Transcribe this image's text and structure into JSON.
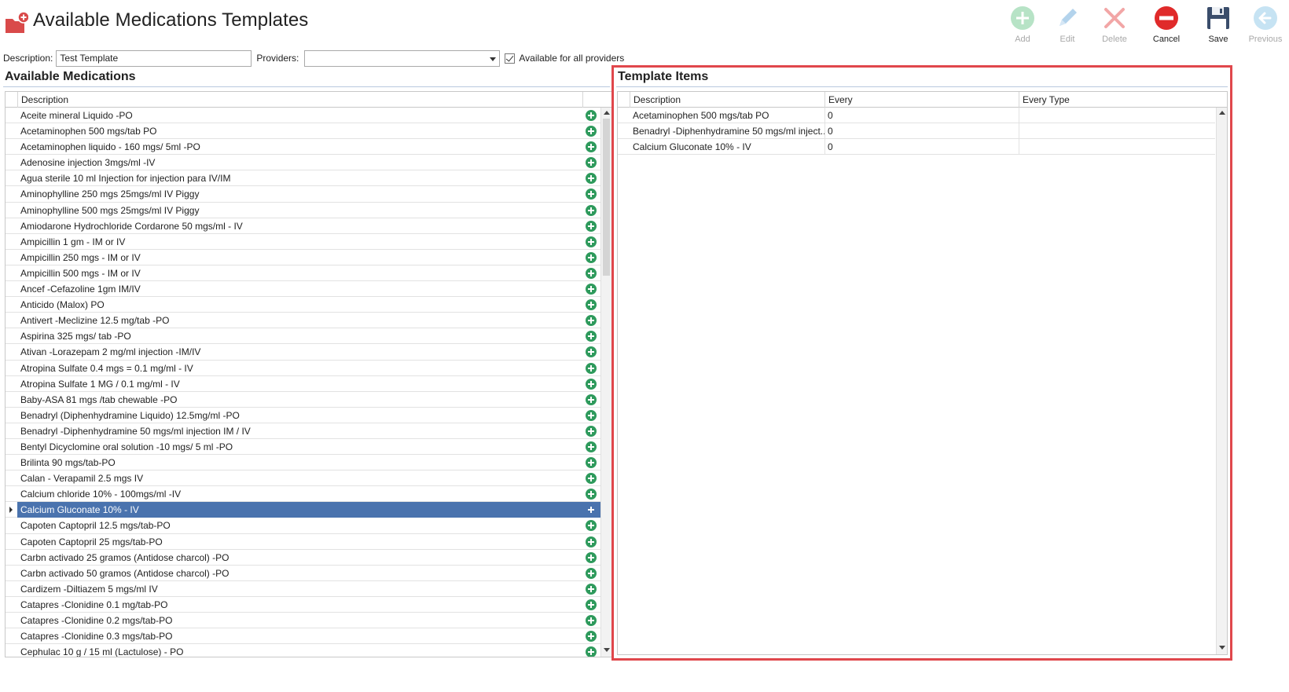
{
  "header": {
    "title": "Available Medications Templates"
  },
  "toolbar": {
    "add": "Add",
    "edit": "Edit",
    "delete": "Delete",
    "cancel": "Cancel",
    "save": "Save",
    "previous": "Previous"
  },
  "form": {
    "description_label": "Description:",
    "description_value": "Test Template",
    "providers_label": "Providers:",
    "providers_value": "",
    "available_all_label": "Available for all providers",
    "available_all_checked": true
  },
  "available": {
    "title": "Available Medications",
    "column": "Description",
    "selected_index": 25,
    "rows": [
      "Aceite mineral Liquido -PO",
      "Acetaminophen 500 mgs/tab PO",
      "Acetaminophen liquido - 160 mgs/ 5ml -PO",
      "Adenosine injection 3mgs/ml -IV",
      "Agua sterile 10 ml Injection for injection para IV/IM",
      "Aminophylline 250 mgs 25mgs/ml IV Piggy",
      "Aminophylline 500 mgs 25mgs/ml IV Piggy",
      "Amiodarone Hydrochloride Cordarone 50 mgs/ml - IV",
      "Ampicillin 1 gm - IM or IV",
      "Ampicillin 250 mgs - IM or IV",
      "Ampicillin 500 mgs - IM or IV",
      "Ancef -Cefazoline  1gm IM/IV",
      "Anticido (Malox) PO",
      "Antivert -Meclizine 12.5 mg/tab -PO",
      "Aspirina 325 mgs/ tab -PO",
      "Ativan -Lorazepam 2 mg/ml injection -IM/IV",
      "Atropina Sulfate 0.4 mgs = 0.1 mg/ml - IV",
      "Atropina Sulfate 1 MG / 0.1 mg/ml - IV",
      "Baby-ASA 81 mgs /tab chewable -PO",
      "Benadryl (Diphenhydramine Liquido) 12.5mg/ml -PO",
      "Benadryl -Diphenhydramine 50 mgs/ml injection IM / IV",
      "Bentyl Dicyclomine oral solution -10 mgs/ 5 ml -PO",
      "Brilinta 90 mgs/tab-PO",
      "Calan - Verapamil 2.5 mgs IV",
      "Calcium chloride 10% - 100mgs/ml -IV",
      "Calcium Gluconate 10% - IV",
      "Capoten Captopril 12.5 mgs/tab-PO",
      "Capoten Captopril 25 mgs/tab-PO",
      "Carbn activado 25 gramos (Antidose charcol) -PO",
      "Carbn activado 50 gramos (Antidose charcol) -PO",
      "Cardizem -Diltiazem 5 mgs/ml  IV",
      "Catapres -Clonidine 0.1 mg/tab-PO",
      "Catapres -Clonidine 0.2 mgs/tab-PO",
      "Catapres -Clonidine 0.3 mgs/tab-PO",
      "Cephulac 10 g / 15 ml (Lactulose) - PO"
    ]
  },
  "template": {
    "title": "Template Items",
    "columns": [
      "Description",
      "Every",
      "Every Type"
    ],
    "rows": [
      [
        "Acetaminophen 500 mgs/tab PO",
        "0",
        ""
      ],
      [
        "Benadryl -Diphenhydramine 50 mgs/ml inject...",
        "0",
        ""
      ],
      [
        "Calcium Gluconate 10% - IV",
        "0",
        ""
      ]
    ]
  },
  "colors": {
    "accent_selected": "#4a73ae",
    "add_green": "#2e9a5c",
    "cancel_red": "#e02a2a",
    "highlight_red": "#e0474c"
  },
  "icons": {
    "title": "folder-add-icon",
    "add": "plus-circle-icon",
    "edit": "pencil-icon",
    "delete": "x-icon",
    "cancel": "no-entry-icon",
    "save": "floppy-disk-icon",
    "previous": "arrow-left-circle-icon",
    "row_add": "plus-circle-icon"
  }
}
